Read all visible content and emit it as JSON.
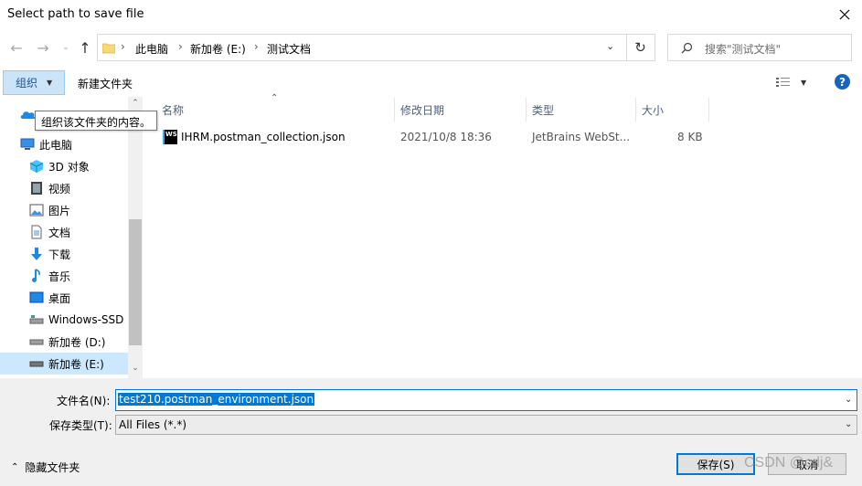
{
  "window": {
    "title": "Select path to save file"
  },
  "address": {
    "crumbs": [
      "此电脑",
      "新加卷 (E:)",
      "测试文档"
    ]
  },
  "search": {
    "placeholder": "搜索\"测试文档\""
  },
  "toolbar": {
    "organize_label": "组织",
    "new_folder_label": "新建文件夹",
    "help_label": "?"
  },
  "tooltip": {
    "text": "组织该文件夹的内容。"
  },
  "sidebar": {
    "items": [
      {
        "label": "此电脑",
        "icon": "computer-icon"
      },
      {
        "label": "3D 对象",
        "icon": "3d-objects-icon"
      },
      {
        "label": "视频",
        "icon": "video-icon"
      },
      {
        "label": "图片",
        "icon": "pictures-icon"
      },
      {
        "label": "文档",
        "icon": "documents-icon"
      },
      {
        "label": "下载",
        "icon": "download-icon"
      },
      {
        "label": "音乐",
        "icon": "music-icon"
      },
      {
        "label": "桌面",
        "icon": "desktop-icon"
      },
      {
        "label": "Windows-SSD",
        "icon": "drive-icon"
      },
      {
        "label": "新加卷 (D:)",
        "icon": "drive-icon"
      },
      {
        "label": "新加卷 (E:)",
        "icon": "drive-icon",
        "selected": true
      }
    ]
  },
  "filelist": {
    "columns": [
      "名称",
      "修改日期",
      "类型",
      "大小"
    ],
    "rows": [
      {
        "name": "IHRM.postman_collection.json",
        "modified": "2021/10/8 18:36",
        "type": "JetBrains WebSt...",
        "size": "8 KB",
        "icon": "webstorm-file-icon"
      }
    ]
  },
  "form": {
    "filename_label": "文件名(N):",
    "filename_value": "test210.postman_environment.json",
    "filetype_label": "保存类型(T):",
    "filetype_value": "All Files (*.*)"
  },
  "footer": {
    "hide_folders_label": "隐藏文件夹",
    "save_label": "保存(S)",
    "cancel_label": "取消"
  },
  "watermark": {
    "text": "CSDN @cdj&"
  },
  "colors": {
    "accent": "#0078d7",
    "selection": "#cce8ff",
    "organize_bg": "#cce4f7",
    "help": "#1565c0"
  }
}
